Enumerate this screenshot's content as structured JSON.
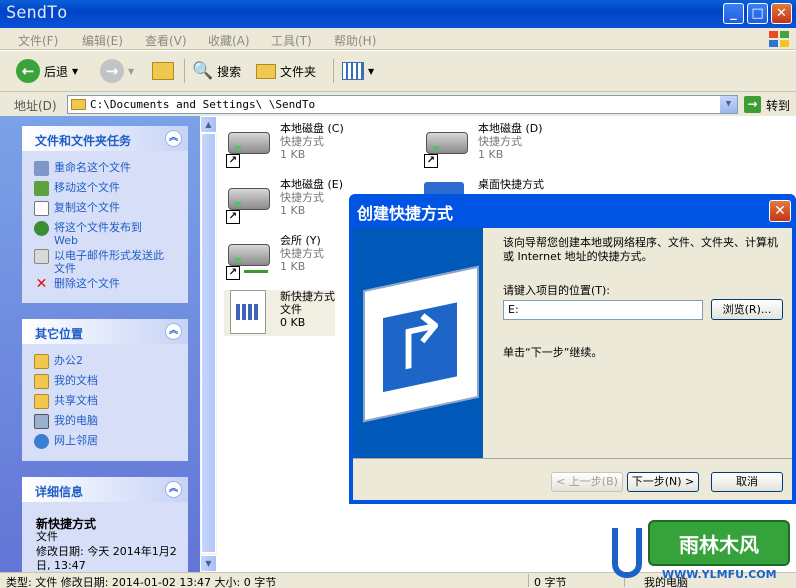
{
  "window": {
    "title": "SendTo",
    "min_label": "_",
    "max_label": "□",
    "close_label": "✕"
  },
  "menu": [
    "文件(F)",
    "编辑(E)",
    "查看(V)",
    "收藏(A)",
    "工具(T)",
    "帮助(H)"
  ],
  "toolbar": {
    "back_label": "后退",
    "search_label": "搜索",
    "folders_label": "文件夹"
  },
  "address": {
    "label": "地址(D)",
    "path": "C:\\Documents and Settings\\    \\SendTo",
    "go_label": "转到"
  },
  "left_pane": {
    "tasks_title": "文件和文件夹任务",
    "tasks": [
      "重命名这个文件",
      "移动这个文件",
      "复制这个文件",
      "将这个文件发布到 Web",
      "以电子邮件形式发送此文件",
      "删除这个文件"
    ],
    "other_title": "其它位置",
    "other": [
      "办公2",
      "我的文档",
      "共享文档",
      "我的电脑",
      "网上邻居"
    ],
    "details_title": "详细信息",
    "details_name": "新快捷方式",
    "details_type": "文件",
    "details_modified": "修改日期: 今天 2014年1月2日, 13:47"
  },
  "files": [
    {
      "name": "本地磁盘 (C)",
      "type": "快捷方式",
      "size": "1 KB"
    },
    {
      "name": "本地磁盘 (D)",
      "type": "快捷方式",
      "size": "1 KB"
    },
    {
      "name": "本地磁盘 (E)",
      "type": "快捷方式",
      "size": "1 KB"
    },
    {
      "name": "桌面快捷方式",
      "type": "",
      "size": ""
    },
    {
      "name": "会所 (Y)",
      "type": "快捷方式",
      "size": "1 KB"
    },
    {
      "name": "新快捷方式",
      "type": "文件",
      "size": "0 KB"
    }
  ],
  "dialog": {
    "title": "创建快捷方式",
    "intro": "该向导帮您创建本地或网络程序、文件、文件夹、计算机或 Internet 地址的快捷方式。",
    "location_label": "请键入项目的位置(T):",
    "location_value": "E:",
    "browse_label": "浏览(R)...",
    "continue_hint": "单击“下一步”继续。",
    "back_label": "< 上一步(B)",
    "next_label": "下一步(N) >",
    "cancel_label": "取消"
  },
  "statusbar": {
    "info": "类型: 文件 修改日期: 2014-01-02 13:47 大小: 0 字节",
    "size": "0 字节",
    "location": "我的电脑"
  },
  "watermark": {
    "brand": "雨林木风",
    "site": "WWW.YLMFU.COM"
  }
}
